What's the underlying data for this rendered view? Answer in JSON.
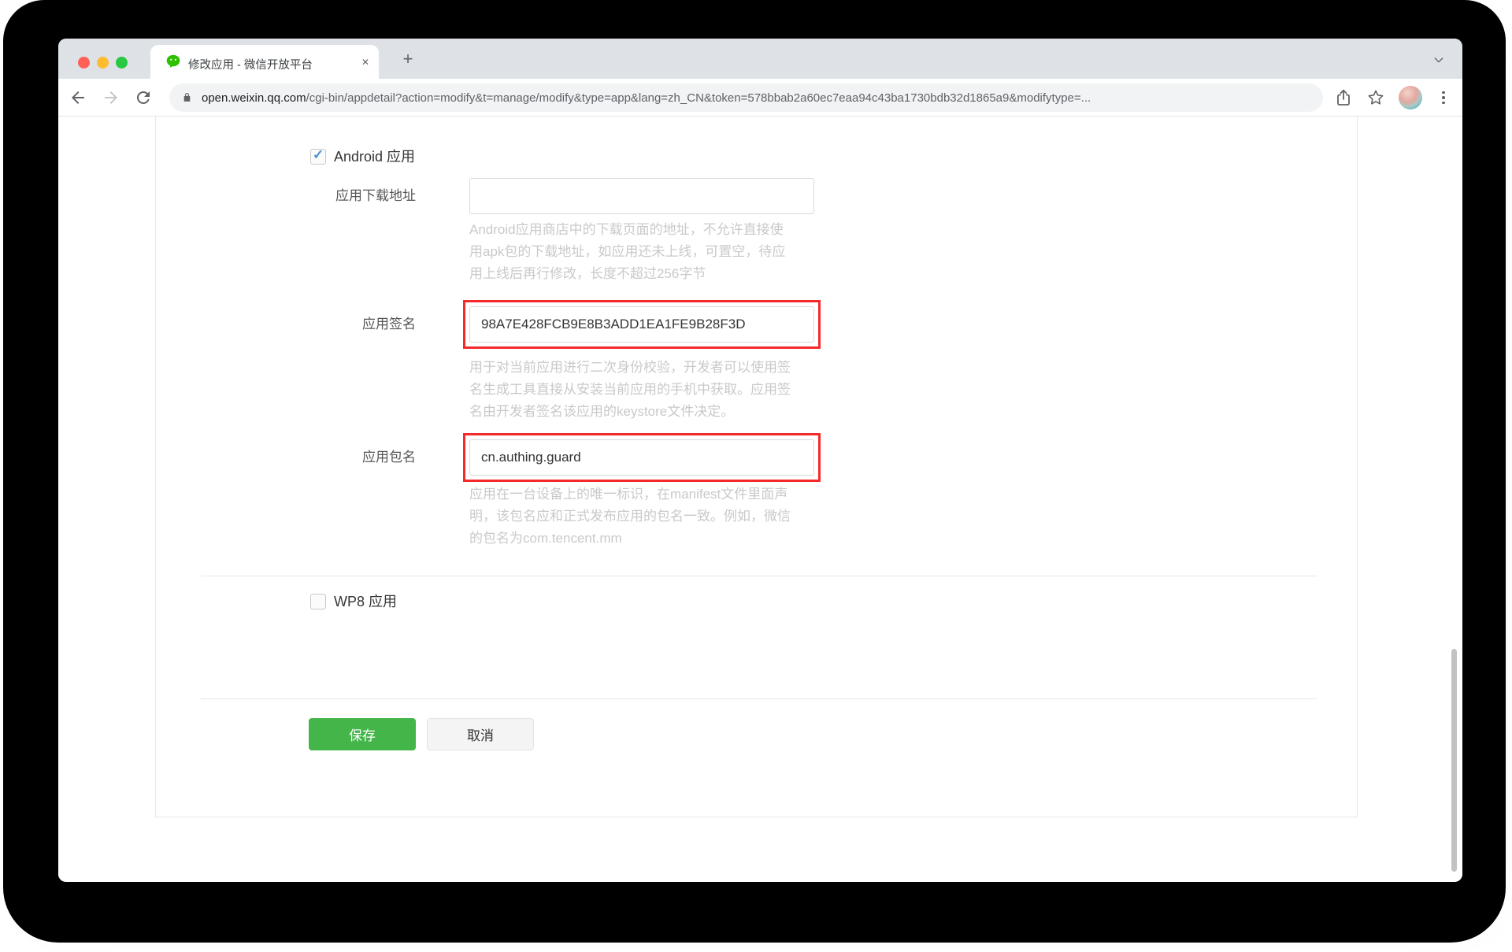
{
  "browser": {
    "tab_title": "修改应用 - 微信开放平台",
    "close_tab_glyph": "✕",
    "new_tab_glyph": "+",
    "url_domain": "open.weixin.qq.com",
    "url_path": "/cgi-bin/appdetail?action=modify&t=manage/modify&type=app&lang=zh_CN&token=578bbab2a60ec7eaa94c43ba1730bdb32d1865a9&modifytype=..."
  },
  "page": {
    "android_section": {
      "label": "Android 应用",
      "checked": true,
      "check_glyph": "✓"
    },
    "fields": [
      {
        "label": "应用下载地址",
        "value": "",
        "highlighted": false,
        "help_lines": [
          "Android应用商店中的下载页面的地址，不允许直接使",
          "用apk包的下载地址，如应用还未上线，可置空，待应",
          "用上线后再行修改，长度不超过256字节"
        ]
      },
      {
        "label": "应用签名",
        "value": "98A7E428FCB9E8B3ADD1EA1FE9B28F3D",
        "highlighted": true,
        "help_lines": [
          "用于对当前应用进行二次身份校验，开发者可以使用签",
          "名生成工具直接从安装当前应用的手机中获取。应用签",
          "名由开发者签名该应用的keystore文件决定。"
        ]
      },
      {
        "label": "应用包名",
        "value": "cn.authing.guard",
        "highlighted": true,
        "help_lines": [
          "应用在一台设备上的唯一标识，在manifest文件里面声",
          "明，该包名应和正式发布应用的包名一致。例如，微信",
          "的包名为com.tencent.mm"
        ]
      }
    ],
    "wp8_section": {
      "label": "WP8 应用",
      "checked": false
    },
    "buttons": {
      "save": "保存",
      "cancel": "取消"
    }
  },
  "colors": {
    "save_green": "#44b549",
    "highlight_red": "#f42a2a",
    "wechat_green": "#2dc100",
    "check_blue": "#4a90d2",
    "tabbar_gray": "#dee1e6"
  }
}
